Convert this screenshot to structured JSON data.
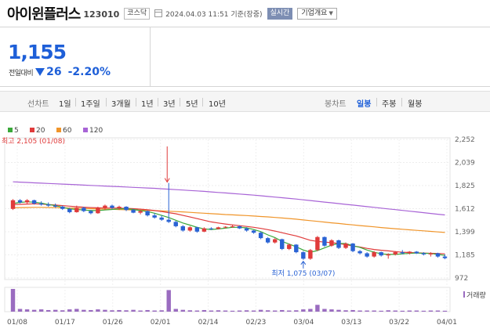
{
  "header": {
    "stock_name": "아이윈플러스",
    "stock_code": "123010",
    "market": "코스닥",
    "datetime": "2024.04.03 11:51",
    "basis": "기준(장중)",
    "realtime_label": "실시간",
    "company_label": "기업개요"
  },
  "price": {
    "current": "1,155",
    "change_label": "전일대비",
    "change": "26",
    "change_pct": "-2.20%",
    "direction": "down",
    "color": "#1e5fd8"
  },
  "period_tabs": {
    "label": "선차트",
    "items": [
      "1일",
      "1주일",
      "3개월",
      "1년",
      "3년",
      "5년",
      "10년"
    ]
  },
  "candle_tabs": {
    "label": "봉차트",
    "items": [
      "일봉",
      "주봉",
      "월봉"
    ],
    "active": "일봉"
  },
  "chart_data": {
    "type": "candlestick",
    "legend": [
      {
        "name": "5",
        "color": "#3aa83a"
      },
      {
        "name": "20",
        "color": "#e03b3b"
      },
      {
        "name": "60",
        "color": "#f0952a"
      },
      {
        "name": "120",
        "color": "#a864d6"
      }
    ],
    "y_ticks": [
      "2,252",
      "2,039",
      "1,825",
      "1,612",
      "1,399",
      "1,185",
      "972"
    ],
    "ylim": [
      972,
      2252
    ],
    "x_ticks": [
      "01/08",
      "01/17",
      "01/26",
      "02/01",
      "02/14",
      "02/23",
      "03/04",
      "03/13",
      "03/22",
      "04/01"
    ],
    "high_annotation": "최고 2,105 (01/08)",
    "low_annotation": "최저 1,075 (03/07)",
    "volume_label": "거래량",
    "up_color": "#e03b3b",
    "down_color": "#2a63d4",
    "candles": [
      [
        1610,
        1700,
        1600,
        1690
      ],
      [
        1690,
        1700,
        1660,
        1670
      ],
      [
        1670,
        1700,
        1655,
        1690
      ],
      [
        1690,
        1695,
        1650,
        1660
      ],
      [
        1660,
        1680,
        1640,
        1650
      ],
      [
        1650,
        1670,
        1630,
        1640
      ],
      [
        1640,
        1660,
        1620,
        1630
      ],
      [
        1630,
        1640,
        1600,
        1610
      ],
      [
        1610,
        1620,
        1570,
        1580
      ],
      [
        1580,
        1640,
        1575,
        1620
      ],
      [
        1620,
        1630,
        1580,
        1590
      ],
      [
        1590,
        1600,
        1560,
        1570
      ],
      [
        1570,
        1630,
        1565,
        1620
      ],
      [
        1620,
        1650,
        1600,
        1640
      ],
      [
        1640,
        1650,
        1610,
        1620
      ],
      [
        1620,
        1640,
        1600,
        1630
      ],
      [
        1630,
        1635,
        1590,
        1600
      ],
      [
        1600,
        1610,
        1570,
        1575
      ],
      [
        1575,
        1600,
        1560,
        1590
      ],
      [
        1590,
        1595,
        1540,
        1550
      ],
      [
        1550,
        1570,
        1520,
        1530
      ],
      [
        1530,
        1550,
        1500,
        1510
      ],
      [
        1510,
        1850,
        1480,
        1490
      ],
      [
        1490,
        1500,
        1440,
        1450
      ],
      [
        1450,
        1460,
        1400,
        1410
      ],
      [
        1410,
        1450,
        1400,
        1440
      ],
      [
        1440,
        1445,
        1390,
        1400
      ],
      [
        1400,
        1440,
        1395,
        1430
      ],
      [
        1430,
        1440,
        1415,
        1425
      ],
      [
        1425,
        1445,
        1420,
        1440
      ],
      [
        1440,
        1450,
        1430,
        1445
      ],
      [
        1445,
        1460,
        1435,
        1450
      ],
      [
        1450,
        1455,
        1425,
        1430
      ],
      [
        1430,
        1440,
        1400,
        1410
      ],
      [
        1410,
        1415,
        1380,
        1390
      ],
      [
        1390,
        1400,
        1330,
        1340
      ],
      [
        1340,
        1350,
        1290,
        1300
      ],
      [
        1300,
        1340,
        1290,
        1330
      ],
      [
        1330,
        1335,
        1230,
        1240
      ],
      [
        1240,
        1290,
        1230,
        1280
      ],
      [
        1280,
        1285,
        1200,
        1210
      ],
      [
        1210,
        1220,
        1140,
        1150
      ],
      [
        1150,
        1240,
        1140,
        1230
      ],
      [
        1230,
        1360,
        1220,
        1350
      ],
      [
        1350,
        1355,
        1260,
        1270
      ],
      [
        1270,
        1330,
        1260,
        1320
      ],
      [
        1320,
        1325,
        1240,
        1250
      ],
      [
        1250,
        1300,
        1240,
        1290
      ],
      [
        1290,
        1295,
        1210,
        1220
      ],
      [
        1220,
        1230,
        1190,
        1200
      ],
      [
        1200,
        1210,
        1160,
        1170
      ],
      [
        1170,
        1220,
        1160,
        1210
      ],
      [
        1210,
        1215,
        1170,
        1180
      ],
      [
        1180,
        1200,
        1150,
        1190
      ],
      [
        1190,
        1220,
        1180,
        1210
      ],
      [
        1210,
        1230,
        1190,
        1200
      ],
      [
        1200,
        1220,
        1190,
        1215
      ],
      [
        1215,
        1220,
        1195,
        1200
      ],
      [
        1200,
        1210,
        1180,
        1190
      ],
      [
        1190,
        1210,
        1170,
        1200
      ],
      [
        1200,
        1205,
        1160,
        1170
      ],
      [
        1170,
        1190,
        1145,
        1155
      ]
    ],
    "ma5": [
      1660,
      1670,
      1675,
      1672,
      1664,
      1650,
      1640,
      1625,
      1610,
      1605,
      1600,
      1595,
      1595,
      1600,
      1605,
      1610,
      1612,
      1605,
      1595,
      1585,
      1570,
      1550,
      1530,
      1505,
      1480,
      1460,
      1440,
      1425,
      1420,
      1425,
      1432,
      1440,
      1440,
      1435,
      1420,
      1400,
      1370,
      1345,
      1310,
      1285,
      1260,
      1230,
      1210,
      1225,
      1250,
      1275,
      1290,
      1290,
      1270,
      1255,
      1230,
      1210,
      1195,
      1190,
      1190,
      1195,
      1200,
      1202,
      1200,
      1198,
      1190,
      1180
    ],
    "ma20": [
      1650,
      1652,
      1655,
      1657,
      1655,
      1650,
      1645,
      1640,
      1635,
      1630,
      1626,
      1622,
      1620,
      1618,
      1618,
      1617,
      1615,
      1612,
      1608,
      1602,
      1595,
      1585,
      1575,
      1565,
      1550,
      1535,
      1520,
      1505,
      1490,
      1480,
      1470,
      1462,
      1455,
      1448,
      1440,
      1430,
      1418,
      1405,
      1390,
      1375,
      1360,
      1340,
      1320,
      1310,
      1303,
      1298,
      1290,
      1280,
      1268,
      1258,
      1245,
      1235,
      1228,
      1222,
      1215,
      1210,
      1207,
      1205,
      1202,
      1200,
      1198,
      1195
    ],
    "ma60": [
      1620,
      1622,
      1623,
      1624,
      1624,
      1623,
      1622,
      1620,
      1618,
      1616,
      1614,
      1612,
      1610,
      1608,
      1606,
      1604,
      1602,
      1600,
      1598,
      1596,
      1594,
      1591,
      1588,
      1585,
      1582,
      1578,
      1574,
      1570,
      1566,
      1562,
      1558,
      1555,
      1551,
      1548,
      1544,
      1540,
      1536,
      1531,
      1526,
      1521,
      1515,
      1508,
      1501,
      1495,
      1488,
      1481,
      1475,
      1468,
      1462,
      1456,
      1450,
      1444,
      1438,
      1432,
      1427,
      1422,
      1417,
      1412,
      1407,
      1402,
      1397,
      1392
    ],
    "ma120": [
      1860,
      1857,
      1854,
      1851,
      1848,
      1845,
      1842,
      1839,
      1836,
      1833,
      1830,
      1827,
      1824,
      1821,
      1818,
      1815,
      1812,
      1809,
      1806,
      1803,
      1800,
      1796,
      1792,
      1788,
      1784,
      1780,
      1776,
      1772,
      1767,
      1762,
      1757,
      1752,
      1747,
      1742,
      1737,
      1731,
      1725,
      1719,
      1713,
      1707,
      1701,
      1694,
      1687,
      1680,
      1673,
      1666,
      1659,
      1652,
      1645,
      1638,
      1631,
      1624,
      1617,
      1610,
      1603,
      1596,
      1589,
      1582,
      1575,
      1568,
      1561,
      1554
    ],
    "volume": [
      1.0,
      0.12,
      0.1,
      0.08,
      0.1,
      0.07,
      0.08,
      0.06,
      0.1,
      0.12,
      0.08,
      0.07,
      0.1,
      0.08,
      0.06,
      0.07,
      0.06,
      0.08,
      0.05,
      0.07,
      0.05,
      0.06,
      0.95,
      0.12,
      0.08,
      0.06,
      0.05,
      0.07,
      0.05,
      0.06,
      0.05,
      0.04,
      0.05,
      0.06,
      0.05,
      0.08,
      0.06,
      0.05,
      0.07,
      0.05,
      0.06,
      0.1,
      0.12,
      0.3,
      0.12,
      0.1,
      0.08,
      0.06,
      0.07,
      0.05,
      0.05,
      0.05,
      0.04,
      0.06,
      0.05,
      0.04,
      0.05,
      0.05,
      0.04,
      0.05,
      0.05,
      0.04
    ]
  }
}
